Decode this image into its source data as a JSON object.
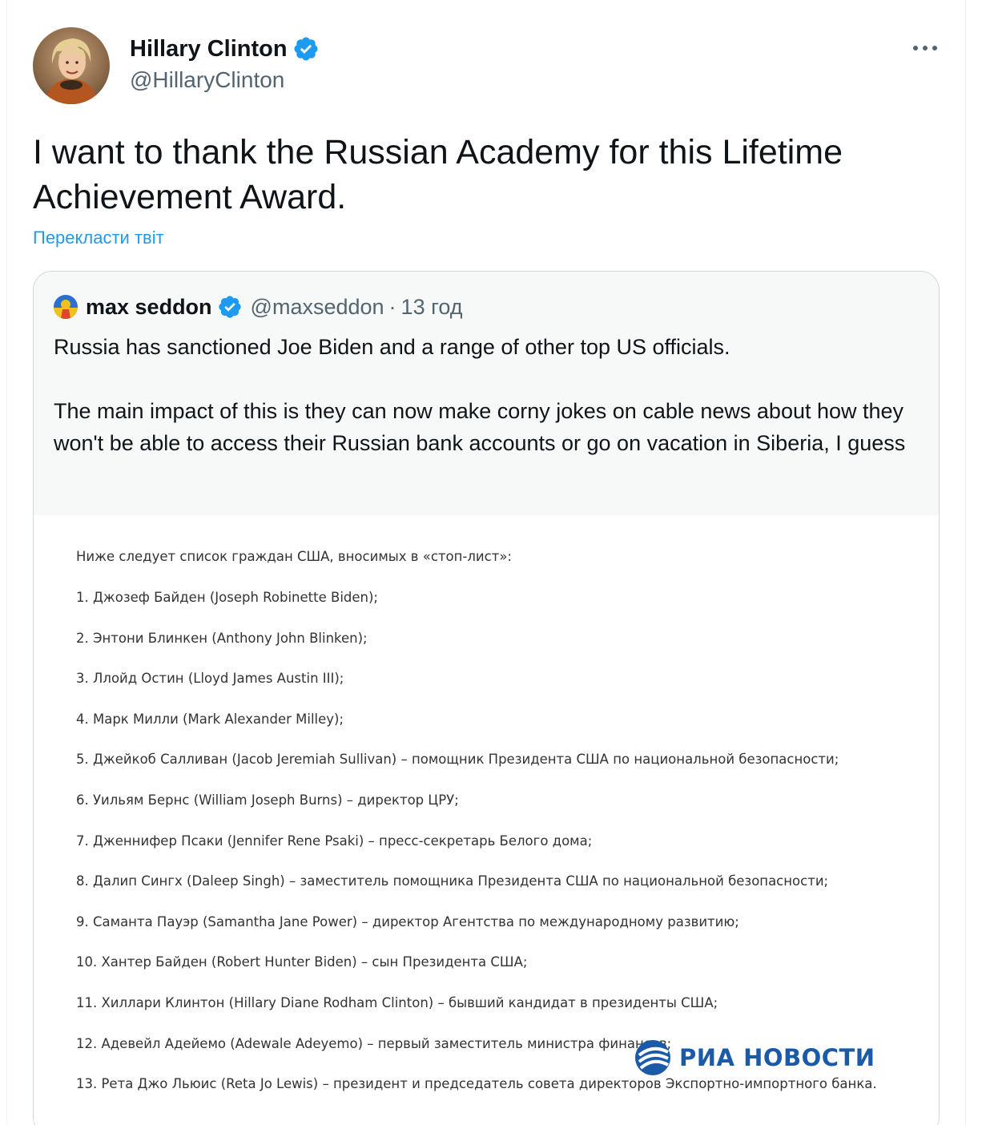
{
  "author": {
    "name": "Hillary Clinton",
    "handle": "@HillaryClinton",
    "verified": true,
    "avatar_icon": "avatar-photo-icon"
  },
  "tweet": {
    "text": "I want to thank the Russian Academy for this Lifetime Achievement Award.",
    "translate_link": "Перекласти твіт",
    "more_icon": "more-dots-icon"
  },
  "quote": {
    "name": "max seddon",
    "handle": "@maxseddon",
    "separator": "·",
    "time": "13 год",
    "verified": true,
    "text": "Russia has sanctioned Joe Biden and a range of other top US officials.\n\nThe main impact of this is they can now make corny jokes on cable news about how they won't be able to access their Russian bank accounts or go on vacation in Siberia, I guess"
  },
  "media": {
    "intro": "Ниже следует список граждан США, вносимых в «стоп-лист»:",
    "items": [
      "1. Джозеф Байден (Joseph Robinette Biden);",
      "2. Энтони Блинкен (Anthony John Blinken);",
      "3. Ллойд Остин (Lloyd James Austin III);",
      "4. Марк Милли (Mark Alexander Milley);",
      "5. Джейкоб Салливан (Jacob Jeremiah Sullivan) – помощник Президента США по национальной безопасности;",
      "6. Уильям Бернс (William Joseph Burns) – директор ЦРУ;",
      "7. Дженнифер Псаки (Jennifer Rene Psaki) – пресс-секретарь Белого дома;",
      "8. Далип Сингх (Daleep Singh) – заместитель помощника Президента США по национальной безопасности;",
      "9. Саманта Пауэр (Samantha Jane Power) – директор Агентства по международному развитию;",
      "10. Хантер Байден (Robert Hunter Biden) – сын Президента США;",
      "11. Хиллари Клинтон (Hillary Diane Rodham Clinton) – бывший кандидат в президенты США;",
      "12. Адевейл Адейемо (Adewale Adeyemo) – первый заместитель министра финансов;",
      "13. Рета Джо Льюис (Reta Jo Lewis) – президент и председатель совета директоров Экспортно-импортного банка."
    ],
    "watermark": "РИА НОВОСТИ",
    "colors": {
      "watermark": "#1a5aa8"
    }
  },
  "colors": {
    "link": "#1d9bf0",
    "secondary": "#536471",
    "verified": "#1d9bf0"
  }
}
